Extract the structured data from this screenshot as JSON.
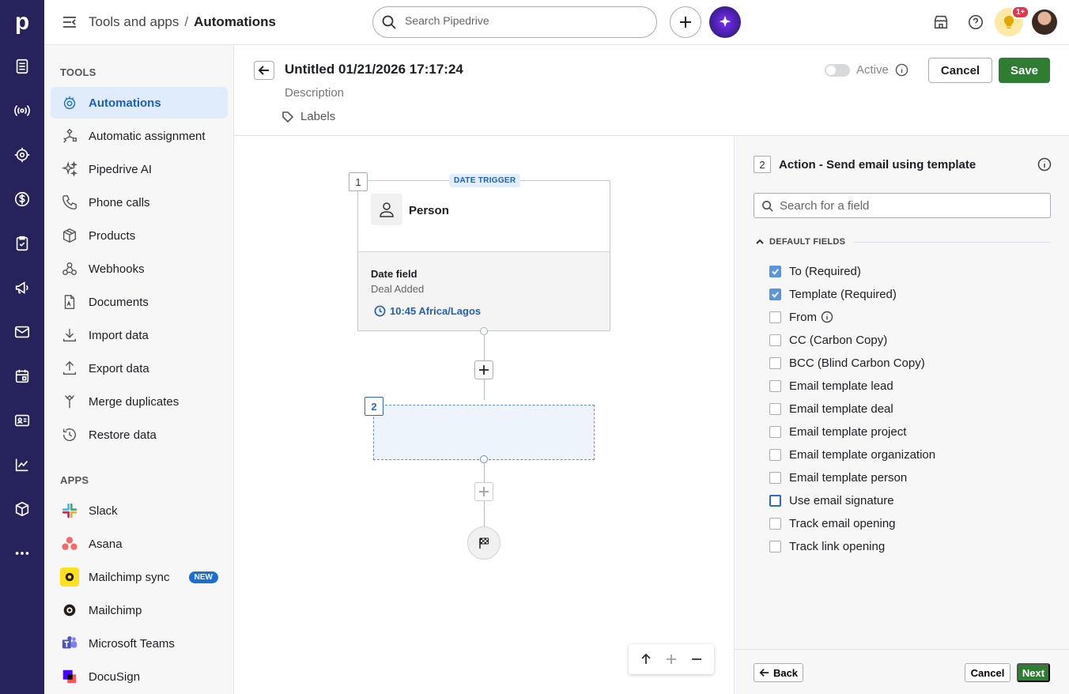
{
  "brand": {
    "logo_letter": "p",
    "nav_color": "#26235c"
  },
  "topbar": {
    "breadcrumb_parent": "Tools and apps",
    "breadcrumb_sep": "/",
    "breadcrumb_current": "Automations",
    "search_placeholder": "Search Pipedrive",
    "notification_badge": "1+"
  },
  "sidebar": {
    "tools_heading": "TOOLS",
    "tools": [
      {
        "label": "Automations",
        "icon": "automations-icon",
        "active": true
      },
      {
        "label": "Automatic assignment",
        "icon": "assignment-icon"
      },
      {
        "label": "Pipedrive AI",
        "icon": "sparkle-icon"
      },
      {
        "label": "Phone calls",
        "icon": "phone-icon"
      },
      {
        "label": "Products",
        "icon": "box-icon"
      },
      {
        "label": "Webhooks",
        "icon": "webhook-icon"
      },
      {
        "label": "Documents",
        "icon": "document-icon"
      },
      {
        "label": "Import data",
        "icon": "import-icon"
      },
      {
        "label": "Export data",
        "icon": "export-icon"
      },
      {
        "label": "Merge duplicates",
        "icon": "merge-icon"
      },
      {
        "label": "Restore data",
        "icon": "restore-icon"
      }
    ],
    "apps_heading": "APPS",
    "apps": [
      {
        "label": "Slack",
        "icon": "slack-icon"
      },
      {
        "label": "Asana",
        "icon": "asana-icon"
      },
      {
        "label": "Mailchimp sync",
        "icon": "mailchimp-sync-icon",
        "badge": "NEW"
      },
      {
        "label": "Mailchimp",
        "icon": "mailchimp-icon"
      },
      {
        "label": "Microsoft Teams",
        "icon": "teams-icon"
      },
      {
        "label": "DocuSign",
        "icon": "docusign-icon"
      }
    ]
  },
  "header": {
    "title": "Untitled 01/21/2026 17:17:24",
    "description_placeholder": "Description",
    "labels": "Labels",
    "active_label": "Active",
    "active": false,
    "cancel": "Cancel",
    "save": "Save"
  },
  "canvas": {
    "trigger": {
      "step": "1",
      "tag": "DATE TRIGGER",
      "entity": "Person",
      "field_title": "Date field",
      "field_value": "Deal Added",
      "time": "10:45 Africa/Lagos"
    },
    "action": {
      "step": "2"
    }
  },
  "panel": {
    "step": "2",
    "title": "Action - Send email using template",
    "search_placeholder": "Search for a field",
    "section": "DEFAULT FIELDS",
    "fields": [
      {
        "label": "To (Required)",
        "checked": true
      },
      {
        "label": "Template (Required)",
        "checked": true
      },
      {
        "label": "From",
        "checked": false,
        "info": true
      },
      {
        "label": "CC (Carbon Copy)",
        "checked": false
      },
      {
        "label": "BCC (Blind Carbon Copy)",
        "checked": false
      },
      {
        "label": "Email template lead",
        "checked": false
      },
      {
        "label": "Email template deal",
        "checked": false
      },
      {
        "label": "Email template project",
        "checked": false
      },
      {
        "label": "Email template organization",
        "checked": false
      },
      {
        "label": "Email template person",
        "checked": false
      },
      {
        "label": "Use email signature",
        "checked": false,
        "focused": true
      },
      {
        "label": "Track email opening",
        "checked": false
      },
      {
        "label": "Track link opening",
        "checked": false
      }
    ],
    "back": "Back",
    "cancel": "Cancel",
    "next": "Next"
  }
}
